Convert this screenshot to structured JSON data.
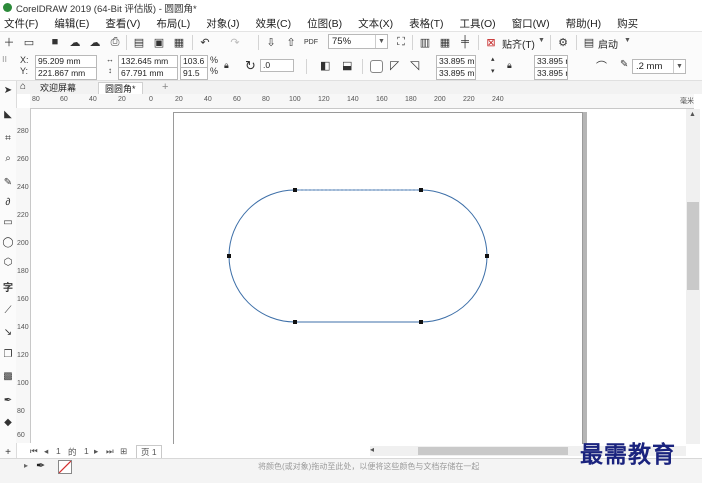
{
  "window": {
    "title": "CorelDRAW 2019 (64-Bit 评估版) - 圆圆角*"
  },
  "menu": [
    "文件(F)",
    "编辑(E)",
    "查看(V)",
    "布局(L)",
    "对象(J)",
    "效果(C)",
    "位图(B)",
    "文本(X)",
    "表格(T)",
    "工具(O)",
    "窗口(W)",
    "帮助(H)",
    "购买"
  ],
  "toolbar": {
    "zoom": "75%",
    "snap_label": "贴齐(T)",
    "launch_label": "启动"
  },
  "properties": {
    "x_label": "X:",
    "y_label": "Y:",
    "x_value": "95.209 mm",
    "y_value": "221.867 mm",
    "width": "132.645 mm",
    "height": "67.791 mm",
    "scale_x": "103.6",
    "scale_y": "91.5",
    "percent": "%",
    "rotation": ".0",
    "corner_tl": "33.895 mm",
    "corner_bl": "33.895 mm",
    "corner_tr": "33.895 mm",
    "corner_br": "33.895 mm",
    "outline_width": ".2 mm"
  },
  "tabs": {
    "welcome": "欢迎屏幕",
    "document": "圆圆角*"
  },
  "ruler": {
    "h_ticks": [
      "80",
      "60",
      "40",
      "20",
      "0",
      "20",
      "40",
      "60",
      "80",
      "100",
      "120",
      "140",
      "160",
      "180",
      "200",
      "220",
      "240"
    ],
    "v_ticks": [
      "280",
      "260",
      "240",
      "220",
      "200",
      "180",
      "160",
      "140",
      "120",
      "100",
      "80",
      "60"
    ],
    "unit": "毫米"
  },
  "page_nav": {
    "current": "1",
    "of": "的",
    "total": "1",
    "page_tab": "页 1"
  },
  "status": {
    "hint": "将颜色(或对象)拖动至此处，以便将这些颜色与文档存储在一起"
  },
  "watermark": "最需教育"
}
